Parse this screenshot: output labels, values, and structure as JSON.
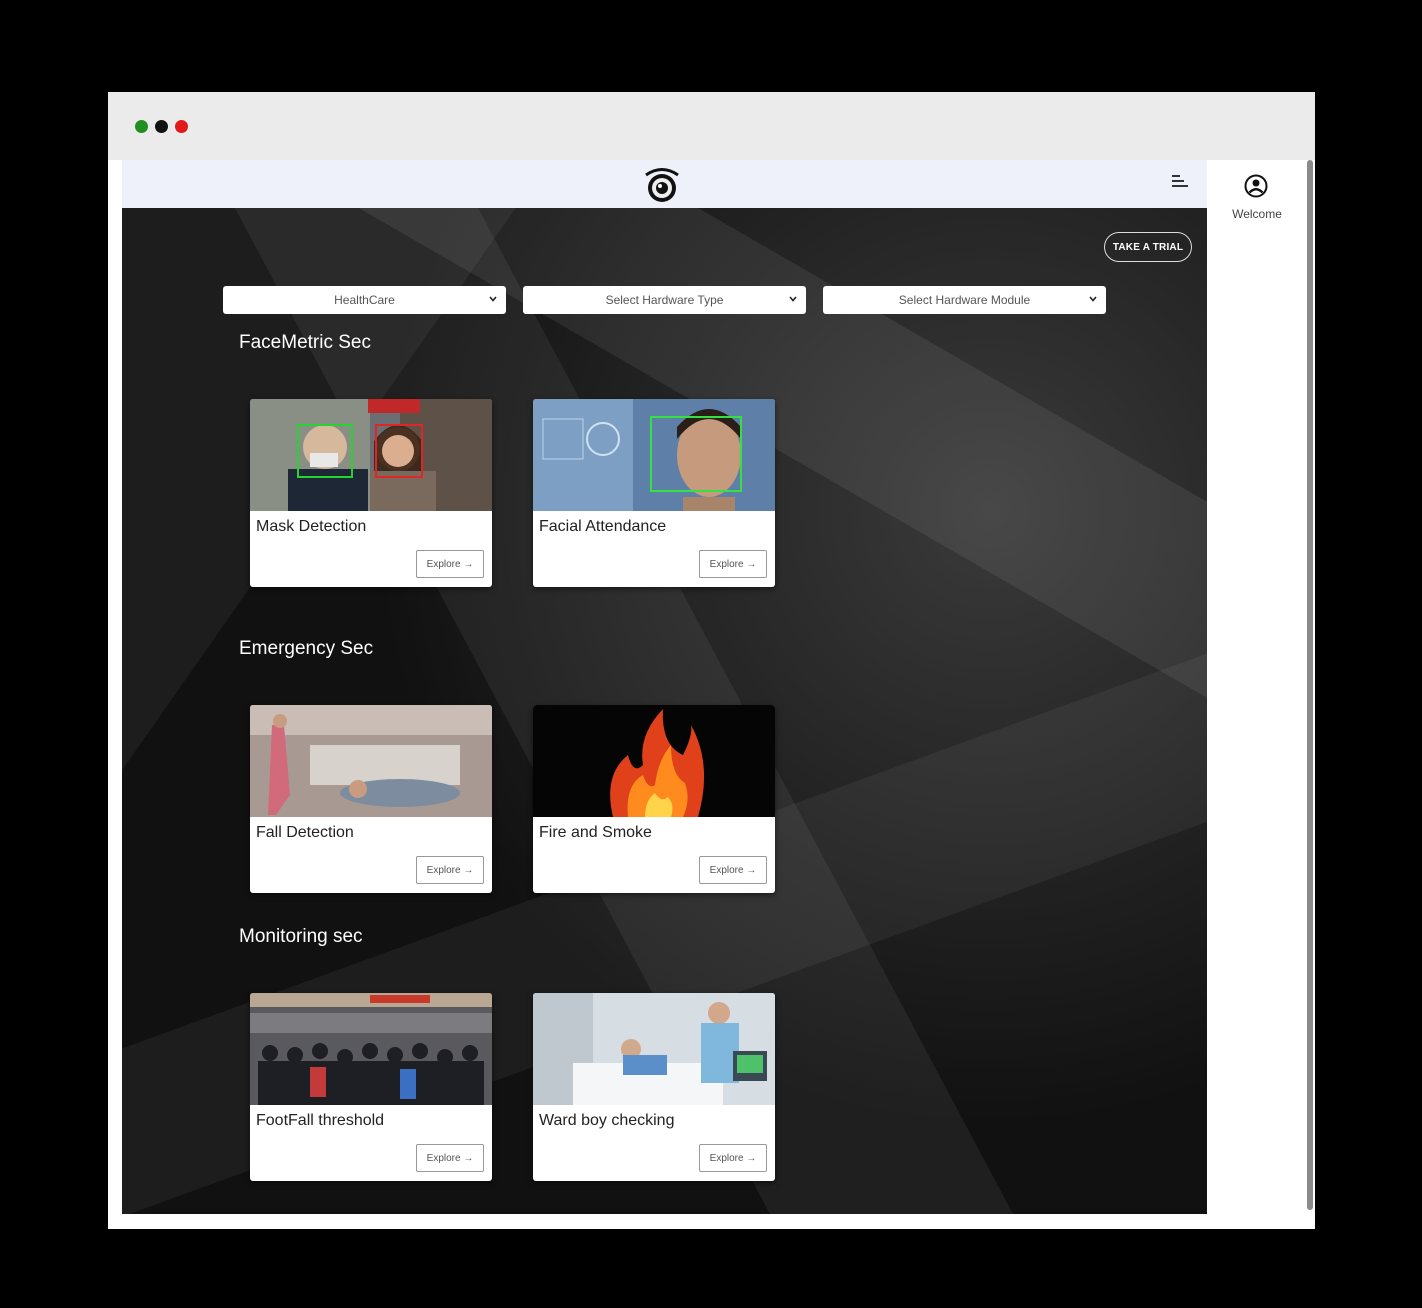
{
  "header": {
    "welcome": "Welcome"
  },
  "actions": {
    "trial_label": "TAKE A TRIAL",
    "explore_label": "Explore →"
  },
  "filters": [
    {
      "value": "HealthCare"
    },
    {
      "value": "Select Hardware Type"
    },
    {
      "value": "Select Hardware Module"
    }
  ],
  "sections": [
    {
      "title": "FaceMetric Sec",
      "cards": [
        {
          "label": "Mask Detection",
          "image": "street-mask-scene"
        },
        {
          "label": "Facial Attendance",
          "image": "face-scan-scene"
        }
      ]
    },
    {
      "title": "Emergency Sec",
      "cards": [
        {
          "label": "Fall Detection",
          "image": "hospital-fall-scene"
        },
        {
          "label": "Fire and Smoke",
          "image": "fire-scene"
        }
      ]
    },
    {
      "title": "Monitoring sec",
      "cards": [
        {
          "label": "FootFall threshold",
          "image": "crowd-scene"
        },
        {
          "label": "Ward boy checking",
          "image": "ward-patient-scene"
        }
      ]
    }
  ],
  "colors": {
    "window_bg": "#ffffff",
    "titlebar": "#ebebeb",
    "appbar": "#eef1fa",
    "content_dark": "#0c0c0c",
    "dot_green": "#1f8f1f",
    "dot_red": "#e01a1a"
  }
}
